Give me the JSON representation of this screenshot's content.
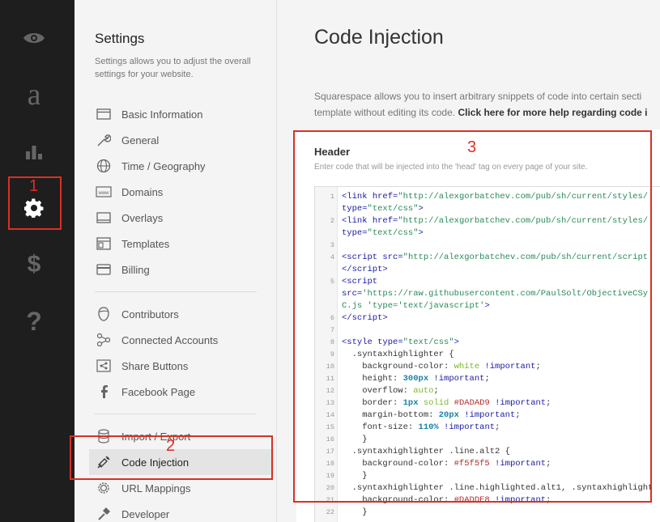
{
  "rail": {
    "items": [
      {
        "name": "preview"
      },
      {
        "name": "commerce",
        "glyph": "a"
      },
      {
        "name": "analytics"
      },
      {
        "name": "settings"
      },
      {
        "name": "billing",
        "glyph": "$"
      },
      {
        "name": "help",
        "glyph": "?"
      }
    ]
  },
  "panel": {
    "title": "Settings",
    "description": "Settings allows you to adjust the overall settings for your website.",
    "items": [
      {
        "label": "Basic Information",
        "icon": "id-card-icon"
      },
      {
        "label": "General",
        "icon": "wrench-icon"
      },
      {
        "label": "Time / Geography",
        "icon": "globe-icon"
      },
      {
        "label": "Domains",
        "icon": "www-icon"
      },
      {
        "label": "Overlays",
        "icon": "overlay-icon"
      },
      {
        "label": "Templates",
        "icon": "template-icon"
      },
      {
        "label": "Billing",
        "icon": "credit-card-icon"
      },
      {
        "label": "Contributors",
        "icon": "user-icon"
      },
      {
        "label": "Connected Accounts",
        "icon": "connected-icon"
      },
      {
        "label": "Share Buttons",
        "icon": "share-icon"
      },
      {
        "label": "Facebook Page",
        "icon": "facebook-icon"
      },
      {
        "label": "Import / Export",
        "icon": "database-icon"
      },
      {
        "label": "Code Injection",
        "icon": "syringe-icon"
      },
      {
        "label": "URL Mappings",
        "icon": "cog-outline-icon"
      },
      {
        "label": "Developer",
        "icon": "hammer-icon"
      }
    ]
  },
  "main": {
    "title": "Code Injection",
    "desc_line1": "Squarespace allows you to insert arbitrary snippets of code into certain secti",
    "desc_line2_prefix": "template without editing its code. ",
    "desc_link": "Click here for more help regarding code i",
    "card": {
      "title": "Header",
      "help": "Enter code that will be injected into the 'head' tag on every page of your site."
    }
  },
  "code_lines": [
    {
      "ln": "1",
      "html": "<span class=\"c-tag\">&lt;link</span> <span class=\"c-attr\">href=</span><span class=\"c-str\">\"http://alexgorbatchev.com/pub/sh/current/styles/</span>"
    },
    {
      "ln": "",
      "html": "<span class=\"c-attr\">type=</span><span class=\"c-str\">\"text/css\"</span><span class=\"c-tag\">&gt;</span>"
    },
    {
      "ln": "2",
      "html": "<span class=\"c-tag\">&lt;link</span> <span class=\"c-attr\">href=</span><span class=\"c-str\">\"http://alexgorbatchev.com/pub/sh/current/styles/</span>"
    },
    {
      "ln": "",
      "html": "<span class=\"c-attr\">type=</span><span class=\"c-str\">\"text/css\"</span><span class=\"c-tag\">&gt;</span>"
    },
    {
      "ln": "3",
      "html": ""
    },
    {
      "ln": "4",
      "html": "<span class=\"c-tag\">&lt;script</span> <span class=\"c-attr\">src=</span><span class=\"c-str\">\"http://alexgorbatchev.com/pub/sh/current/script</span>"
    },
    {
      "ln": "",
      "html": "<span class=\"c-tag\">&lt;/script&gt;</span>"
    },
    {
      "ln": "5",
      "html": "<span class=\"c-tag\">&lt;script</span>"
    },
    {
      "ln": "",
      "html": "<span class=\"c-attr\">src=</span><span class=\"c-str\">'https://raw.githubusercontent.com/PaulSolt/ObjectiveCSy</span>"
    },
    {
      "ln": "",
      "html": "<span class=\"c-str\">C.js</span> <span class=\"c-str\">'type='text/javascript'</span><span class=\"c-tag\">&gt;</span>"
    },
    {
      "ln": "6",
      "html": "<span class=\"c-tag\">&lt;/script&gt;</span>"
    },
    {
      "ln": "7",
      "html": ""
    },
    {
      "ln": "8",
      "html": "<span class=\"c-tag\">&lt;style</span> <span class=\"c-attr\">type=</span><span class=\"c-str\">\"text/css\"</span><span class=\"c-tag\">&gt;</span>"
    },
    {
      "ln": "9",
      "html": "  .syntaxhighlighter {"
    },
    {
      "ln": "10",
      "html": "    background-color: <span class=\"c-val\">white</span> <span class=\"c-imp\">!important</span>;"
    },
    {
      "ln": "11",
      "html": "    height: <span class=\"c-num\">300px</span> <span class=\"c-imp\">!important</span>;"
    },
    {
      "ln": "12",
      "html": "    overflow: <span class=\"c-val\">auto</span>;"
    },
    {
      "ln": "13",
      "html": "    border: <span class=\"c-num\">1px</span> <span class=\"c-val\">solid</span> <span class=\"c-hex\">#DADAD9</span> <span class=\"c-imp\">!important</span>;"
    },
    {
      "ln": "14",
      "html": "    margin-bottom: <span class=\"c-num\">20px</span> <span class=\"c-imp\">!important</span>;"
    },
    {
      "ln": "15",
      "html": "    font-size: <span class=\"c-num\">110%</span> <span class=\"c-imp\">!important</span>;"
    },
    {
      "ln": "16",
      "html": "    }"
    },
    {
      "ln": "17",
      "html": "  .syntaxhighlighter .line.alt2 {"
    },
    {
      "ln": "18",
      "html": "    background-color: <span class=\"c-hex\">#f5f5f5</span> <span class=\"c-imp\">!important</span>;"
    },
    {
      "ln": "19",
      "html": "    }"
    },
    {
      "ln": "20",
      "html": "  .syntaxhighlighter .line.highlighted.alt1, .syntaxhighlight"
    },
    {
      "ln": "21",
      "html": "    background-color: <span class=\"c-hex\">#DADDE8</span> <span class=\"c-imp\">!important</span>;"
    },
    {
      "ln": "22",
      "html": "    }"
    }
  ],
  "annotations": [
    {
      "label": "1"
    },
    {
      "label": "2"
    },
    {
      "label": "3"
    }
  ]
}
